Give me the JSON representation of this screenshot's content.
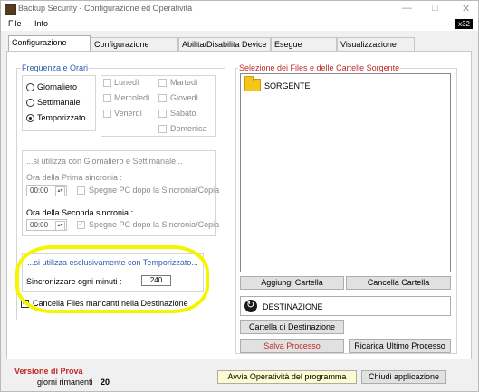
{
  "window": {
    "title": "Backup Security  -  Configurazione ed Operatività",
    "minimize": "—",
    "maximize": "□",
    "close": "✕"
  },
  "menu": {
    "file": "File",
    "info": "Info",
    "arch": "x32"
  },
  "tabs": [
    "Configurazione Copie",
    "Configurazione Devices",
    "Abilita/Disabilita Device",
    "Esegue Processo",
    "Visualizzazione LOG"
  ],
  "frequenza": {
    "title": "Frequenza e Orari",
    "options": [
      "Giornaliero",
      "Settimanale",
      "Temporizzato"
    ],
    "selected": "Temporizzato"
  },
  "giorni": {
    "lunedi": "Lunedì",
    "martedi": "Martedì",
    "mercoledi": "Mercoledì",
    "giovedi": "Giovedì",
    "venerdi": "Venerdì",
    "sabato": "Sabato",
    "domenica": "Domenica"
  },
  "sincronia": {
    "title": "...si utilizza con Giornaliero e Settimanale...",
    "prima_label": "Ora della Prima  sincronia :",
    "prima_value": "00:00",
    "prima_spegne": "Spegne PC dopo la Sincronia/Copia",
    "seconda_label": "Ora della Seconda  sincronia :",
    "seconda_value": "00:00",
    "seconda_spegne": "Spegne PC dopo la Sincronia/Copia",
    "seconda_spegne_checked": true
  },
  "temporizzato": {
    "title": "...si utilizza esclusivamente con Temporizzato...",
    "label": "Sincronizzare ogni minuti :",
    "value": "240"
  },
  "cancella": {
    "label": "Cancella Files mancanti nella Destinazione",
    "checked": true
  },
  "selezione": {
    "title": "Selezione dei Files e delle  Cartelle Sorgente",
    "item": "SORGENTE",
    "aggiungi": "Aggiungi Cartella",
    "cancella": "Cancella Cartella",
    "destinazione": "DESTINAZIONE",
    "cartella_dest": "Cartella di Destinazione",
    "salva": "Salva Processo",
    "ricarica": "Ricarica Ultimo Processo"
  },
  "status": {
    "versione": "Versione di Prova",
    "giorni_label": "giorni rimanenti",
    "giorni_value": "20",
    "avvia": "Avvia Operatività del programma",
    "chiudi": "Chiudi applicazione"
  },
  "colors": {
    "highlight": "#f5f500",
    "accent_red": "#c0292a",
    "accent_blue": "#3060b0"
  }
}
